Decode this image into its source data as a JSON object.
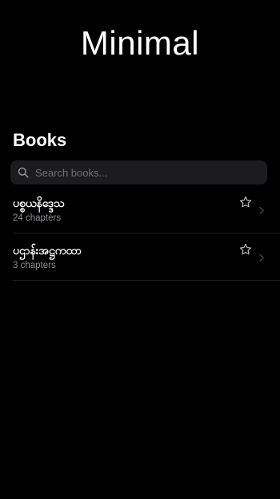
{
  "app": {
    "title": "Minimal"
  },
  "books_section": {
    "title": "Books"
  },
  "search": {
    "placeholder": "Search books...",
    "icon": "search-icon"
  },
  "books": [
    {
      "title": "ပစ္စယနိဒ္ဒေသ",
      "chapters": "24 chapters",
      "favorite_icon": "star-outline-icon",
      "favorited": false
    },
    {
      "title": "ပဌာန်းအဋ္ဌကထာ",
      "chapters": "3 chapters",
      "favorite_icon": "star-outline-icon",
      "favorited": false
    }
  ],
  "colors": {
    "background": "#000000",
    "search_background": "#1c1c1e",
    "secondary_text": "#8e8e93",
    "placeholder_text": "#6e6e73",
    "divider": "#1f1f1f"
  }
}
